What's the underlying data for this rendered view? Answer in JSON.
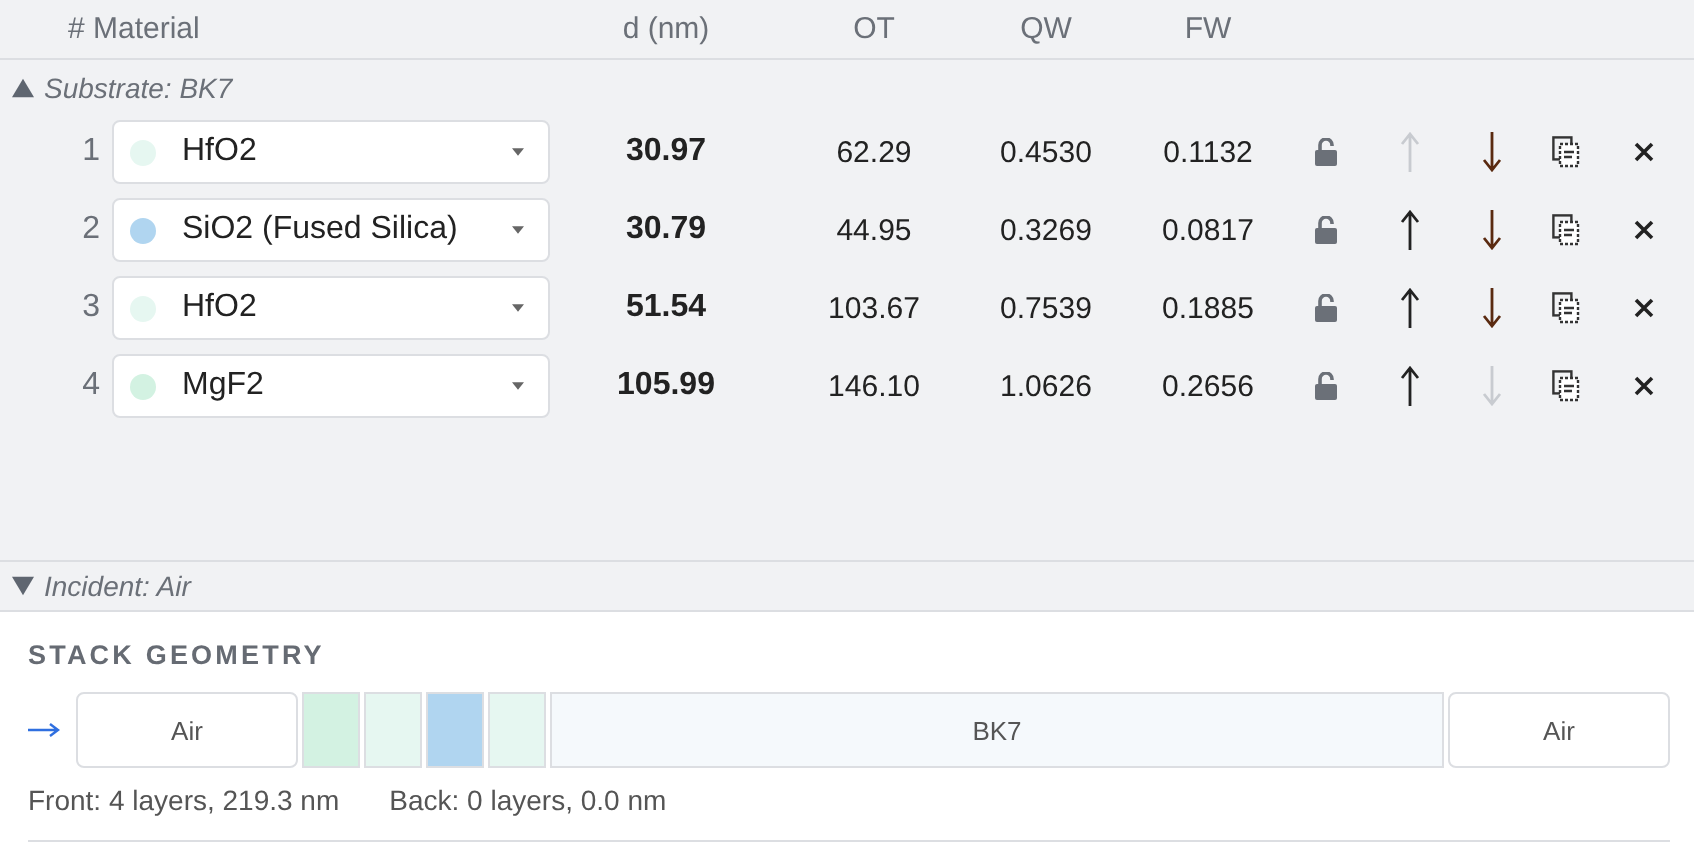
{
  "table": {
    "columns": [
      "# Material",
      "d (nm)",
      "OT",
      "QW",
      "FW"
    ],
    "substrate_label": "Substrate: BK7",
    "rows": [
      {
        "index": "1",
        "material": "HfO2",
        "color": "#e6f7f1",
        "d": "30.97",
        "ot": "62.29",
        "qw": "0.4530",
        "fw": "0.1132",
        "up_disabled": true,
        "down_disabled": false
      },
      {
        "index": "2",
        "material": "SiO2 (Fused Silica)",
        "color": "#b0d5f0",
        "d": "30.79",
        "ot": "44.95",
        "qw": "0.3269",
        "fw": "0.0817",
        "up_disabled": false,
        "down_disabled": false
      },
      {
        "index": "3",
        "material": "HfO2",
        "color": "#e6f7f1",
        "d": "51.54",
        "ot": "103.67",
        "qw": "0.7539",
        "fw": "0.1885",
        "up_disabled": false,
        "down_disabled": false
      },
      {
        "index": "4",
        "material": "MgF2",
        "color": "#d3f2e2",
        "d": "105.99",
        "ot": "146.10",
        "qw": "1.0626",
        "fw": "0.2656",
        "up_disabled": false,
        "down_disabled": true
      }
    ],
    "incident_label": "Incident: Air"
  },
  "stack_geometry": {
    "title": "STACK GEOMETRY",
    "segments": [
      {
        "kind": "ambient",
        "label": "Air"
      },
      {
        "kind": "layer",
        "color": "#d3f2e2"
      },
      {
        "kind": "layer",
        "color": "#e6f7f1"
      },
      {
        "kind": "layer",
        "color": "#b0d5f0"
      },
      {
        "kind": "layer",
        "color": "#e6f7f1"
      },
      {
        "kind": "substrate",
        "label": "BK7"
      },
      {
        "kind": "ambient",
        "label": "Air"
      }
    ],
    "front_summary": "Front: 4 layers, 219.3 nm",
    "back_summary": "Back: 0 layers, 0.0 nm"
  }
}
